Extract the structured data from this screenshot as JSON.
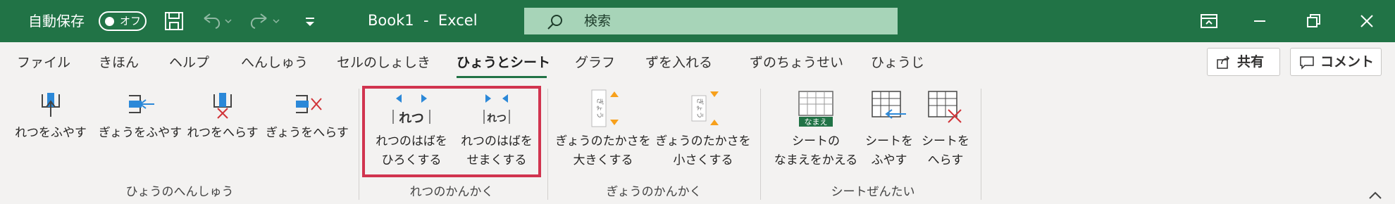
{
  "titlebar": {
    "autosave_label": "自動保存",
    "autosave_state": "オフ",
    "document_title": "Book1  -  Excel",
    "search_placeholder": "検索",
    "background_color": "#217346"
  },
  "tabs": [
    {
      "label": "ファイル"
    },
    {
      "label": "きほん"
    },
    {
      "label": "ヘルプ"
    },
    {
      "label": "へんしゅう"
    },
    {
      "label": "セルのしょしき"
    },
    {
      "label": "ひょうとシート",
      "active": true
    },
    {
      "label": "グラフ"
    },
    {
      "label": "ずを入れる"
    },
    {
      "label": "ずのちょうせい"
    },
    {
      "label": "ひょうじ"
    }
  ],
  "share_label": "共有",
  "comment_label": "コメント",
  "groups": [
    {
      "label": "ひょうのへんしゅう",
      "commands": [
        {
          "label": "れつをふやす"
        },
        {
          "label": "ぎょうをふやす"
        },
        {
          "label": "れつをへらす"
        },
        {
          "label": "ぎょうをへらす"
        }
      ]
    },
    {
      "label": "れつのかんかく",
      "commands": [
        {
          "label": "れつのはばを\nひろくする",
          "icon_text": "れつ"
        },
        {
          "label": "れつのはばを\nせまくする",
          "icon_text": "れつ"
        }
      ]
    },
    {
      "label": "ぎょうのかんかく",
      "commands": [
        {
          "label": "ぎょうのたかさを\n大きくする",
          "icon_text": "ぎょう"
        },
        {
          "label": "ぎょうのたかさを\n小さくする",
          "icon_text": "ぎょう"
        }
      ]
    },
    {
      "label": "シートぜんたい",
      "commands": [
        {
          "label": "シートの\nなまえをかえる",
          "icon_text": "なまえ"
        },
        {
          "label": "シートを\nふやす"
        },
        {
          "label": "シートを\nへらす"
        }
      ]
    }
  ],
  "colors": {
    "accent": "#217346",
    "highlight": "#d1344f",
    "icon_blue": "#2b88d8",
    "icon_red": "#d13438",
    "icon_orange": "#f7a01b"
  }
}
